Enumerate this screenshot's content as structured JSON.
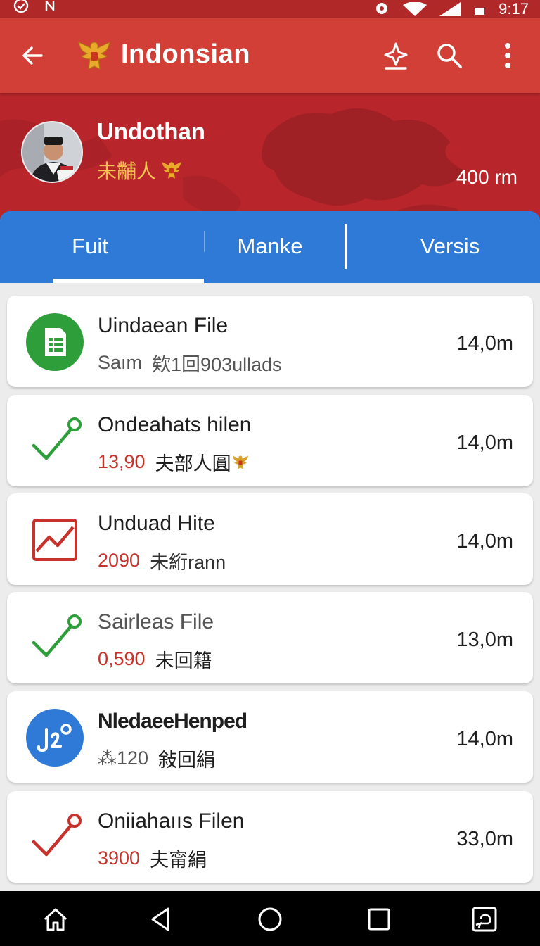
{
  "status_bar": {
    "time": "9:17"
  },
  "app_bar": {
    "title": "Indonsian"
  },
  "profile": {
    "name": "Undothan",
    "subtitle": "未黼人",
    "meta": "400 rm"
  },
  "tabs": [
    {
      "label": "Fuit",
      "selected": true
    },
    {
      "label": "Manke",
      "selected": false
    },
    {
      "label": "Versis",
      "selected": false
    }
  ],
  "files": [
    {
      "title": "Uindaean File",
      "number": "Saım",
      "detail": "欸1回903ullads",
      "size": "14,0m",
      "icon": "spreadsheet-icon"
    },
    {
      "title": "Ondeahats hilen",
      "number": "13,90",
      "detail": "夫部人圓",
      "size": "14,0m",
      "icon": "check-icon"
    },
    {
      "title": "Unduad Hite",
      "number": "2090",
      "detail": "未絎rann",
      "size": "14,0m",
      "icon": "chart-icon"
    },
    {
      "title": "Sairleas File",
      "number": "0,590",
      "detail": "未回籍",
      "size": "13,0m",
      "icon": "check-icon"
    },
    {
      "title": "NledaeeHenped",
      "number": "⁂120",
      "detail": "敍回絹",
      "size": "14,0m",
      "icon": "music-icon"
    },
    {
      "title": "Oniiahaııs Filen",
      "number": "3900",
      "detail": "夫甯絹",
      "size": "33,0m",
      "icon": "check-icon"
    }
  ],
  "colors": {
    "app_bar": "#d23f36",
    "tab_bar": "#2f7ad6",
    "accent_red": "#c8322c",
    "green": "#2e9e3a",
    "gold": "#f6c451"
  }
}
